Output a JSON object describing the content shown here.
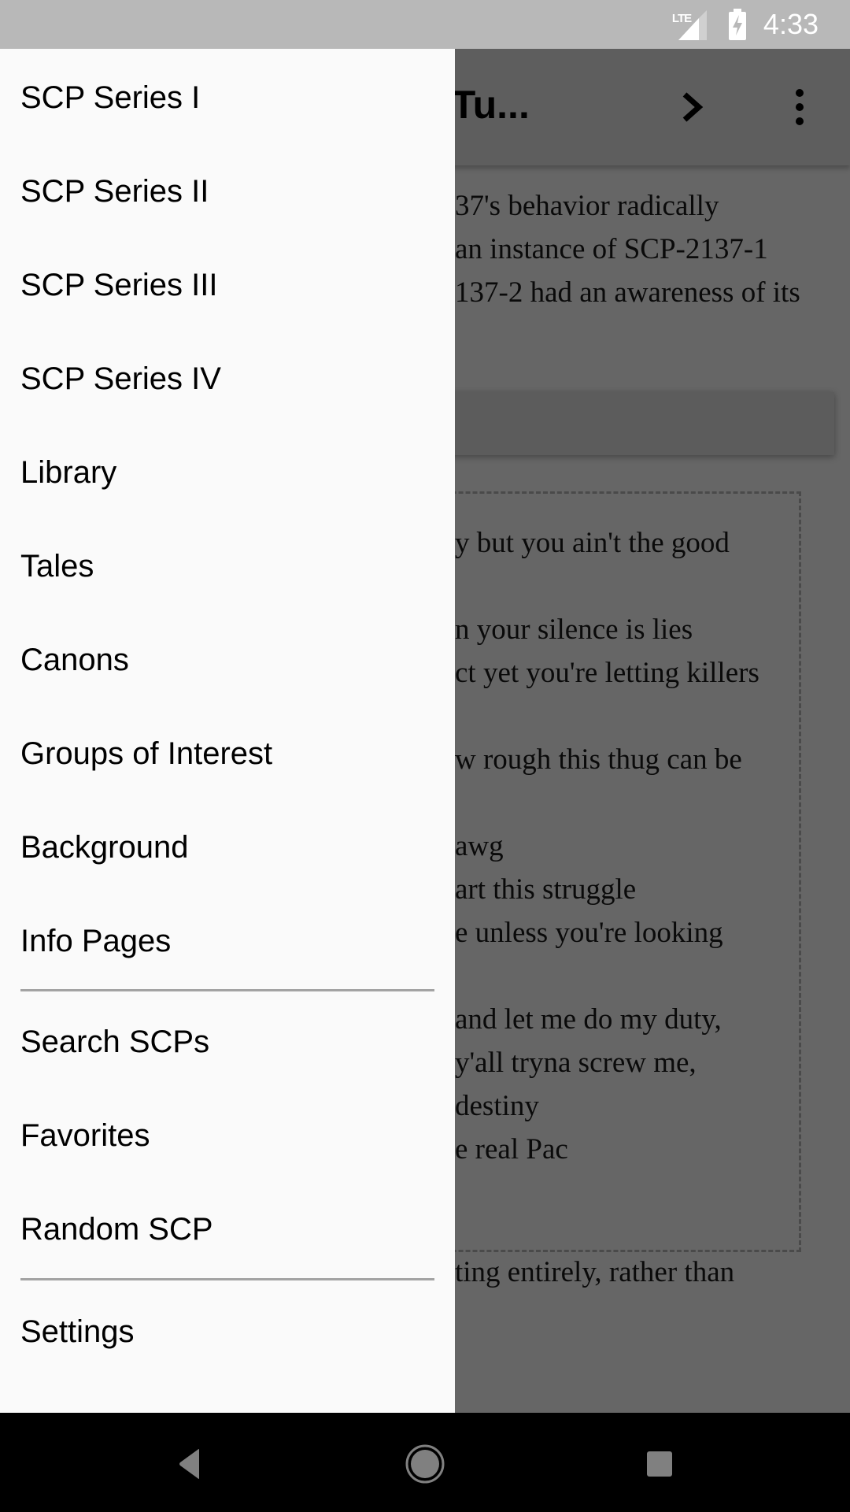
{
  "status_bar": {
    "network_label": "LTE",
    "time": "4:33",
    "icons": [
      "lte-signal-icon",
      "battery-charging-icon"
    ]
  },
  "toolbar": {
    "title": "st Of Tu...",
    "next_icon": "chevron-right-icon",
    "more_icon": "more-vert-icon"
  },
  "article": {
    "intro_lines": [
      "37's behavior radically",
      "an instance of SCP-2137-1",
      "137-2 had an awareness of its"
    ],
    "quote_lines": [
      "y but you ain't the good",
      "",
      "n your silence is lies",
      "ct yet you're letting killers",
      "",
      "w rough this thug can be",
      "",
      "awg",
      "art this struggle",
      "e unless you're looking",
      "",
      "and let me do my duty,",
      "y'all tryna screw me,",
      "destiny",
      "e real Pac"
    ],
    "after_line": "ting entirely, rather than"
  },
  "drawer": {
    "group1": [
      {
        "label": "SCP Series I"
      },
      {
        "label": "SCP Series II"
      },
      {
        "label": "SCP Series III"
      },
      {
        "label": "SCP Series IV"
      },
      {
        "label": "Library"
      },
      {
        "label": "Tales"
      },
      {
        "label": "Canons"
      },
      {
        "label": "Groups of Interest"
      },
      {
        "label": "Background"
      },
      {
        "label": "Info Pages"
      }
    ],
    "group2": [
      {
        "label": "Search SCPs"
      },
      {
        "label": "Favorites"
      },
      {
        "label": "Random SCP"
      }
    ],
    "group3": [
      {
        "label": "Settings"
      }
    ]
  },
  "nav_bar": {
    "buttons": [
      "back-icon",
      "home-icon",
      "recents-icon"
    ]
  }
}
